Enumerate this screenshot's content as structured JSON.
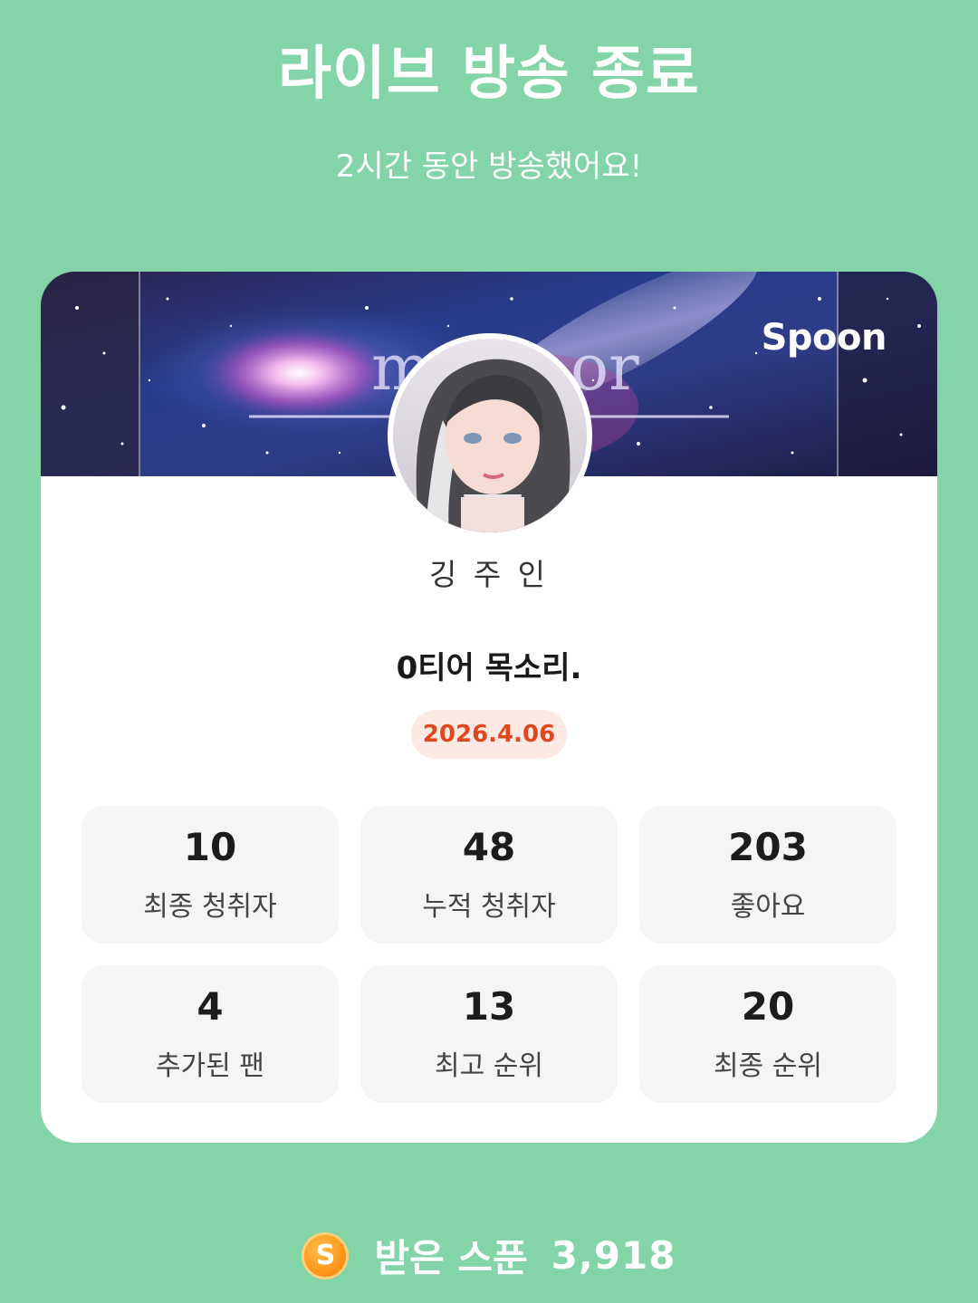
{
  "header": {
    "title": "라이브 방송 종료",
    "subtitle": "2시간 동안 방송했어요!"
  },
  "card": {
    "brand": "Spoon",
    "host_name": "깅 주 인",
    "live_title": "0티어 목소리.",
    "date": "2026.4.06",
    "stats": [
      {
        "value": "10",
        "label": "최종 청취자"
      },
      {
        "value": "48",
        "label": "누적 청취자"
      },
      {
        "value": "203",
        "label": "좋아요"
      },
      {
        "value": "4",
        "label": "추가된 팬"
      },
      {
        "value": "13",
        "label": "최고 순위"
      },
      {
        "value": "20",
        "label": "최종 순위"
      }
    ]
  },
  "footer": {
    "coin_icon": "spoon-coin-icon",
    "coin_letter": "S",
    "label": "받은 스푼",
    "value": "3,918"
  },
  "colors": {
    "background": "#83d4a6",
    "date_text": "#e1471f",
    "date_bg": "#fde9e3",
    "stat_bg": "#f5f5f5"
  }
}
